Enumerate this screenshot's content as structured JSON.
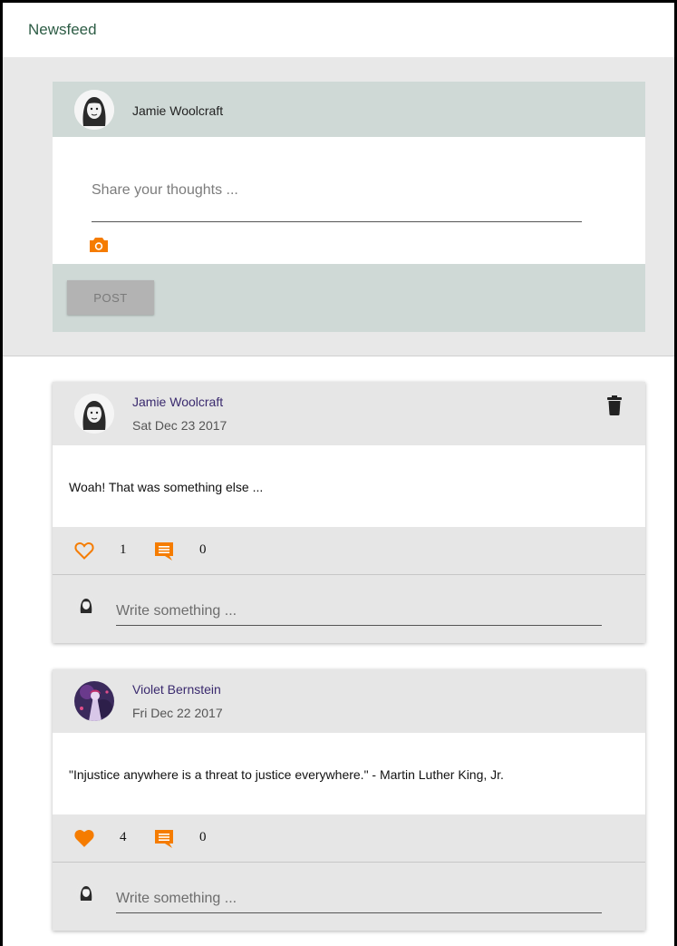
{
  "header": {
    "title": "Newsfeed"
  },
  "compose": {
    "user_name": "Jamie Woolcraft",
    "placeholder": "Share your thoughts ...",
    "camera_icon": "camera-icon",
    "post_label": "POST"
  },
  "posts": [
    {
      "author": "Jamie Woolcraft",
      "date": "Sat Dec 23 2017",
      "text": "Woah! That was something else ...",
      "likes": "1",
      "comments": "0",
      "liked": false,
      "deletable": true,
      "comment_placeholder": "Write something ..."
    },
    {
      "author": "Violet Bernstein",
      "date": "Fri Dec 22 2017",
      "text": "\"Injustice anywhere is a threat to justice everywhere.\" - Martin Luther King, Jr.",
      "likes": "4",
      "comments": "0",
      "liked": true,
      "deletable": false,
      "comment_placeholder": "Write something ..."
    }
  ],
  "colors": {
    "accent": "#f57c00",
    "header_title": "#2e5d46",
    "card_head": "#cfd9d6",
    "author_name": "#3a2a6e"
  }
}
